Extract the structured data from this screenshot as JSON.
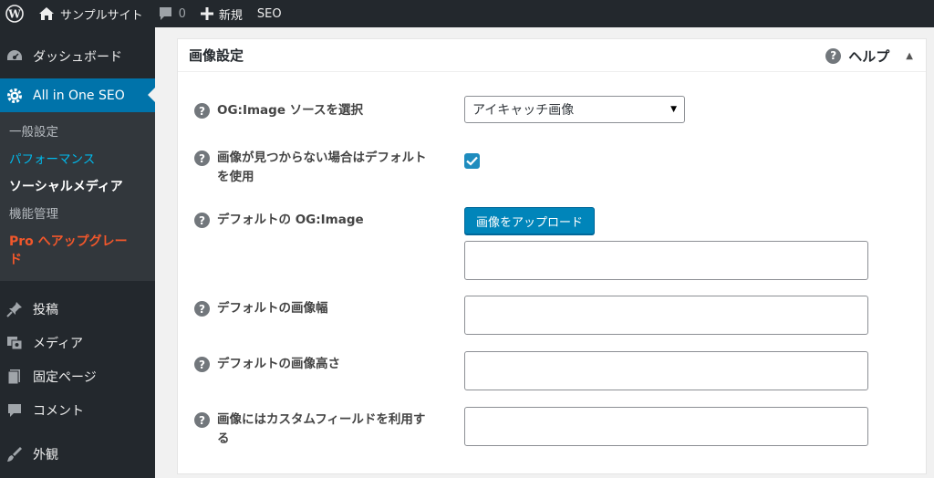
{
  "admin_bar": {
    "site_name": "サンプルサイト",
    "comments_count": "0",
    "new_label": "新規",
    "seo_label": "SEO"
  },
  "sidebar": {
    "dashboard": "ダッシュボード",
    "aioseo": "All in One SEO",
    "submenu": {
      "general": "一般設定",
      "performance": "パフォーマンス",
      "social": "ソーシャルメディア",
      "features": "機能管理",
      "upgrade_line1": "Pro へアップグレー",
      "upgrade_line2": "ド"
    },
    "posts": "投稿",
    "media": "メディア",
    "pages": "固定ページ",
    "comments": "コメント",
    "appearance": "外観"
  },
  "panel": {
    "title": "画像設定",
    "help": "ヘルプ"
  },
  "settings": {
    "og_source_label": "OG:Image ソースを選択",
    "og_source_value": "アイキャッチ画像",
    "use_default_label": "画像が見つからない場合はデフォルトを使用",
    "use_default_checked": true,
    "default_og_label": "デフォルトの OG:Image",
    "upload_button": "画像をアップロード",
    "default_og_value": "",
    "default_width_label": "デフォルトの画像幅",
    "default_width_value": "",
    "default_height_label": "デフォルトの画像高さ",
    "default_height_value": "",
    "custom_field_label": "画像にはカスタムフィールドを利用する",
    "custom_field_value": ""
  },
  "colors": {
    "admin_dark": "#23282d",
    "submenu_bg": "#32373c",
    "accent_blue": "#0073aa",
    "button_blue": "#0085ba",
    "upgrade_orange": "#f1572b",
    "link_blue": "#00b9eb"
  },
  "icons": {
    "wp_logo": "wordpress-logo-icon",
    "home": "home-icon",
    "comment": "comment-bubble-icon",
    "plus": "plus-icon",
    "dashboard": "gauge-icon",
    "aioseo": "gear-icon",
    "posts": "pushpin-icon",
    "media": "media-icon",
    "pages": "pages-icon",
    "comments": "comment-icon",
    "appearance": "paintbrush-icon",
    "help": "question-icon",
    "toggle": "triangle-up-icon"
  }
}
